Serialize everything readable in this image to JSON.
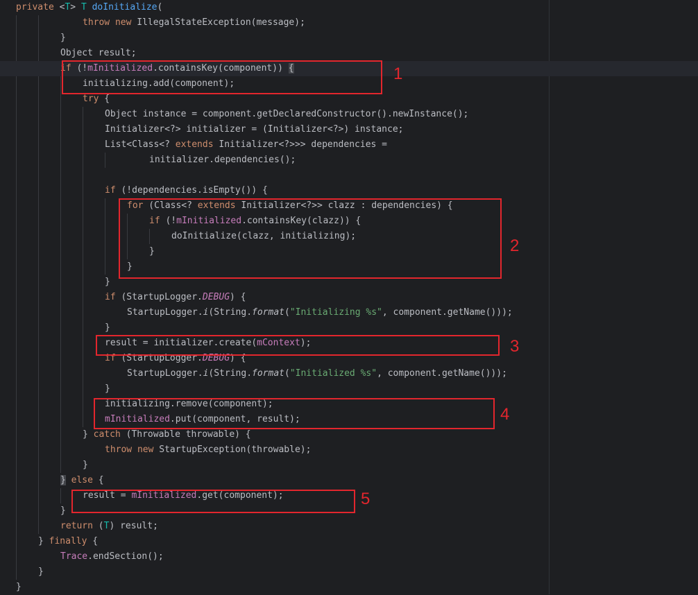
{
  "code_lines": [
    "private <T> T doInitialize(",
    "throw new IllegalStateException(message);",
    "}",
    "Object result;",
    "if (!mInitialized.containsKey(component)) {",
    "initializing.add(component);",
    "try {",
    "Object instance = component.getDeclaredConstructor().newInstance();",
    "Initializer<?> initializer = (Initializer<?>) instance;",
    "List<Class<? extends Initializer<?>>> dependencies =",
    "initializer.dependencies();",
    "",
    "if (!dependencies.isEmpty()) {",
    "for (Class<? extends Initializer<?>> clazz : dependencies) {",
    "if (!mInitialized.containsKey(clazz)) {",
    "doInitialize(clazz, initializing);",
    "}",
    "}",
    "}",
    "if (StartupLogger.DEBUG) {",
    "StartupLogger.i(String.format(\"Initializing %s\", component.getName()));",
    "}",
    "result = initializer.create(mContext);",
    "if (StartupLogger.DEBUG) {",
    "StartupLogger.i(String.format(\"Initialized %s\", component.getName()));",
    "}",
    "initializing.remove(component);",
    "mInitialized.put(component, result);",
    "} catch (Throwable throwable) {",
    "throw new StartupException(throwable);",
    "}",
    "} else {",
    "result = mInitialized.get(component);",
    "}",
    "return (T) result;",
    "} finally {",
    "Trace.endSection();",
    "}",
    "}"
  ],
  "annotations": [
    "1",
    "2",
    "3",
    "4",
    "5"
  ],
  "colors": {
    "background": "#1e1f22",
    "text": "#bcbec4",
    "keyword": "#cf8e6d",
    "field": "#c77dbb",
    "method_decl": "#56a8f5",
    "type_param": "#16baac",
    "string": "#6aab73",
    "annotation_red": "#e3262d"
  }
}
